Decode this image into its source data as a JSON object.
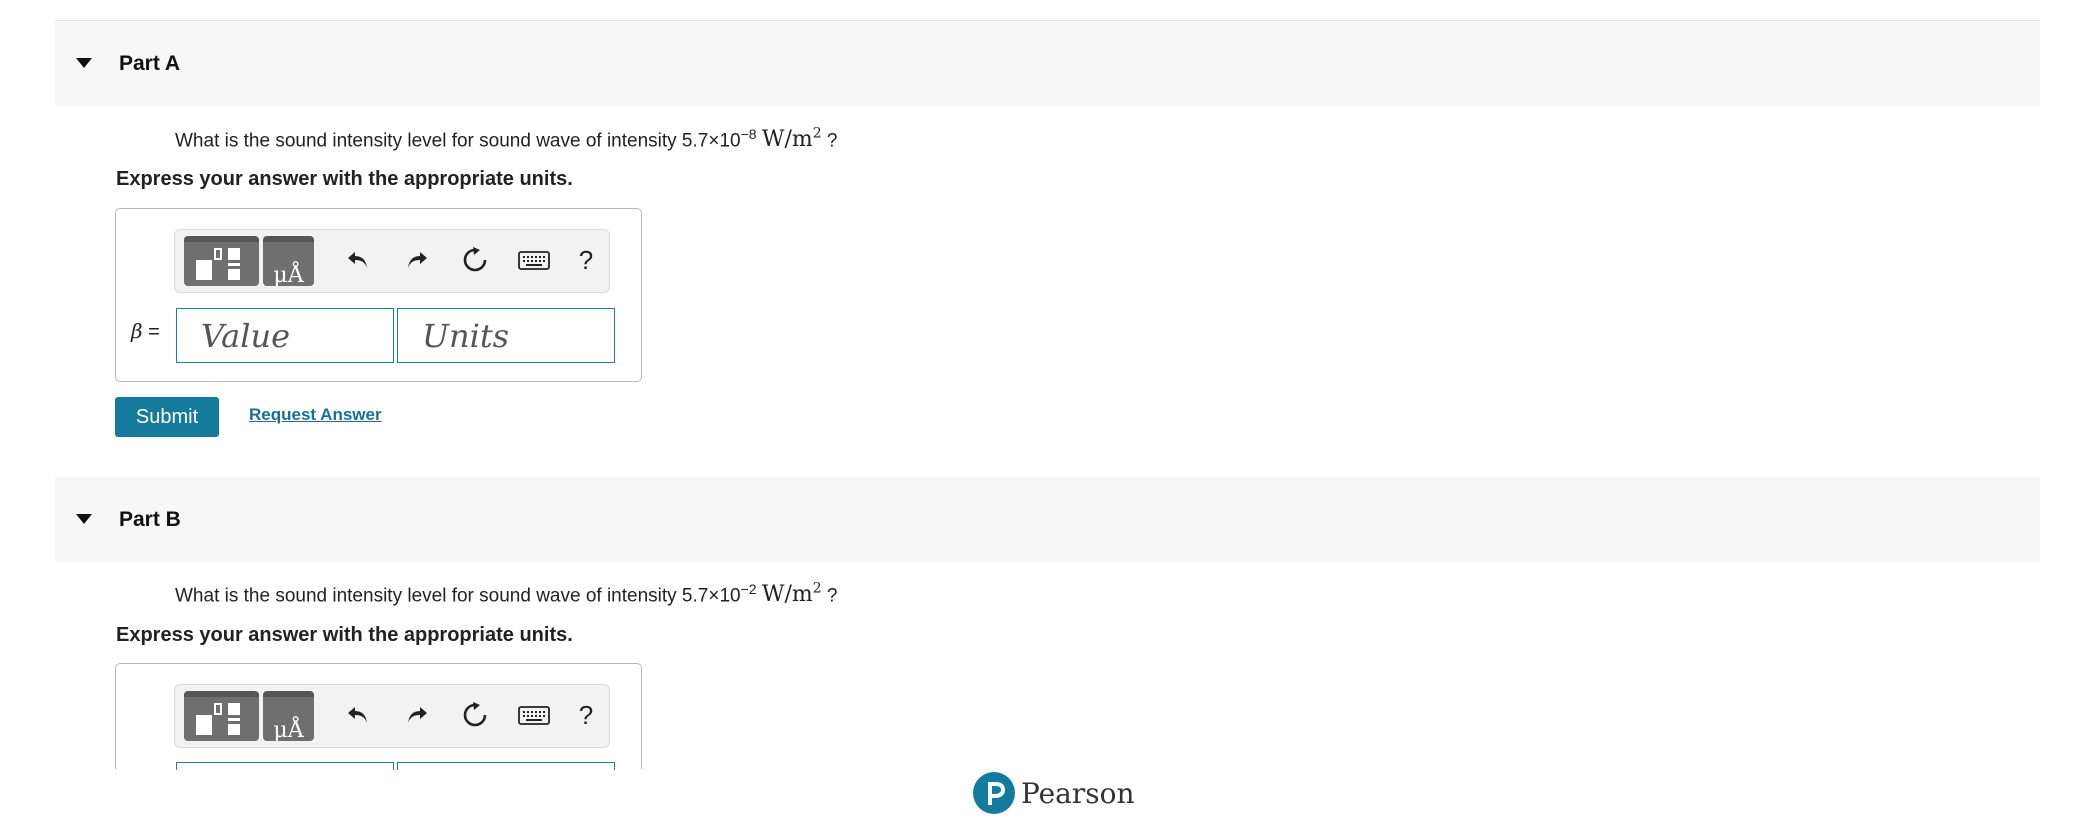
{
  "part_a": {
    "title": "Part A",
    "question_prefix": "What is the sound intensity level for sound wave of intensity 5.7×10",
    "exponent": "−8",
    "unit_base": "W/m",
    "unit_power": "2",
    "question_suffix": " ?",
    "instruction": "Express your answer with the appropriate units.",
    "variable_label": "β",
    "equals": "=",
    "value_placeholder": "Value",
    "units_placeholder": "Units",
    "submit_label": "Submit",
    "request_answer_label": "Request Answer"
  },
  "part_b": {
    "title": "Part B",
    "question_prefix": "What is the sound intensity level for sound wave of intensity 5.7×10",
    "exponent": "−2",
    "unit_base": "W/m",
    "unit_power": "2",
    "question_suffix": " ?",
    "instruction": "Express your answer with the appropriate units."
  },
  "toolbar": {
    "templates_icon": "templates-icon",
    "symbols_icon": "symbols-icon",
    "symbols_glyph": "μÅ",
    "undo_icon": "undo-icon",
    "redo_icon": "redo-icon",
    "reset_icon": "reset-icon",
    "keyboard_icon": "keyboard-icon",
    "help_label": "?"
  },
  "footer": {
    "brand": "Pearson",
    "brand_color": "#127b9e"
  },
  "colors": {
    "accent": "#157b9c",
    "link": "#1a6f95",
    "header_bg": "#f7f7f7"
  }
}
